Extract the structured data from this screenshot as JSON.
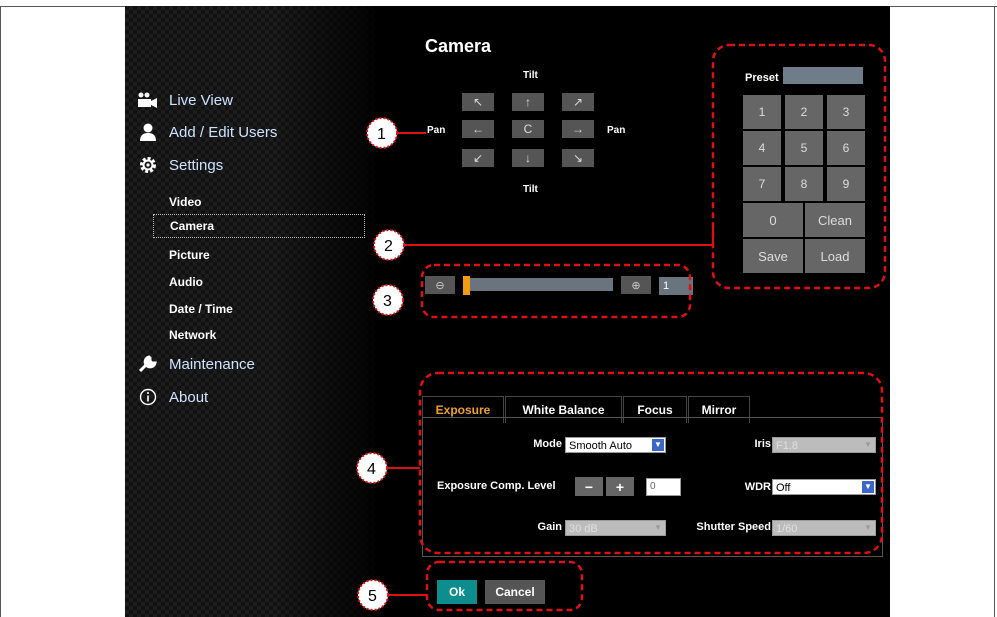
{
  "window": {
    "title": "Camera"
  },
  "sidebar": {
    "main_items": [
      {
        "label": "Live View",
        "icon": "video-camera-icon"
      },
      {
        "label": "Add / Edit Users",
        "icon": "user-icon"
      },
      {
        "label": "Settings",
        "icon": "gear-icon"
      }
    ],
    "sub_items": [
      "Video",
      "Camera",
      "Picture",
      "Audio",
      "Date / Time",
      "Network"
    ],
    "active_sub": "Camera",
    "bottom_items": [
      {
        "label": "Maintenance",
        "icon": "wrench-icon"
      },
      {
        "label": "About",
        "icon": "info-icon"
      }
    ]
  },
  "ptz": {
    "tilt_label": "Tilt",
    "pan_label": "Pan",
    "buttons": [
      "↖",
      "↑",
      "↗",
      "←",
      "C",
      "→",
      "↙",
      "↓",
      "↘"
    ]
  },
  "preset": {
    "label": "Preset",
    "input_value": "",
    "keys": [
      "1",
      "2",
      "3",
      "4",
      "5",
      "6",
      "7",
      "8",
      "9"
    ],
    "zero": "0",
    "clean": "Clean",
    "save": "Save",
    "load": "Load"
  },
  "zoom": {
    "out_icon": "zoom-out-icon",
    "in_icon": "zoom-in-icon",
    "value": "1",
    "level_fraction": 0.0
  },
  "tabs": [
    "Exposure",
    "White Balance",
    "Focus",
    "Mirror"
  ],
  "active_tab": "Exposure",
  "exposure": {
    "mode_label": "Mode",
    "mode_value": "Smooth Auto",
    "iris_label": "Iris",
    "iris_value": "F1.8",
    "comp_label": "Exposure Comp. Level",
    "comp_minus": "−",
    "comp_plus": "+",
    "comp_value": "0",
    "wdr_label": "WDR",
    "wdr_value": "Off",
    "gain_label": "Gain",
    "gain_value": "30 dB",
    "shutter_label": "Shutter Speed",
    "shutter_value": "1/60"
  },
  "actions": {
    "ok": "Ok",
    "cancel": "Cancel"
  },
  "callouts": [
    "1",
    "2",
    "3",
    "4",
    "5"
  ],
  "colors": {
    "callout": "#dd1111",
    "accent_tab": "#f0a030",
    "ok_button": "#0d8d8d"
  }
}
